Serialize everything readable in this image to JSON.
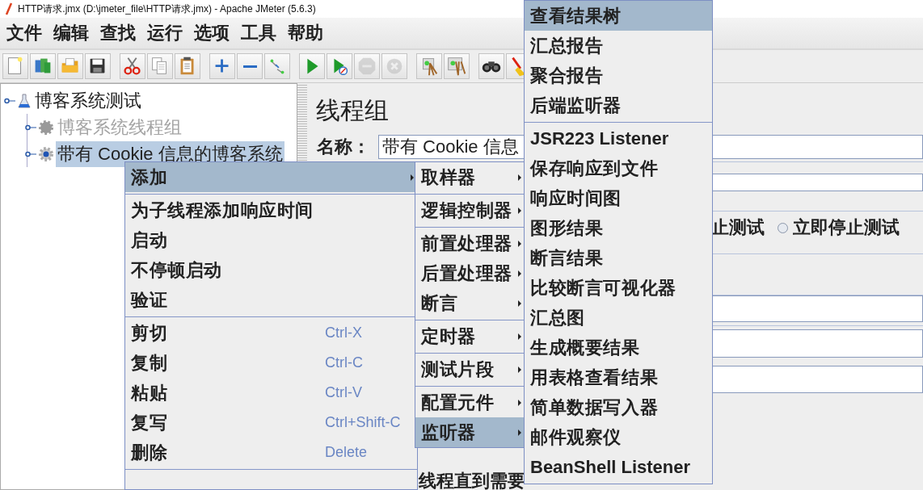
{
  "window": {
    "title": "HTTP请求.jmx (D:\\jmeter_file\\HTTP请求.jmx) - Apache JMeter (5.6.3)"
  },
  "menu_bar": [
    "文件",
    "编辑",
    "查找",
    "运行",
    "选项",
    "工具",
    "帮助"
  ],
  "toolbar": [
    [
      {
        "kind": "new",
        "disabled": false
      },
      {
        "kind": "templates",
        "disabled": false
      },
      {
        "kind": "open",
        "disabled": false
      },
      {
        "kind": "save",
        "disabled": false
      }
    ],
    [
      {
        "kind": "cut",
        "disabled": false
      },
      {
        "kind": "copy",
        "disabled": false
      },
      {
        "kind": "paste",
        "disabled": false
      }
    ],
    [
      {
        "kind": "expand",
        "disabled": false
      },
      {
        "kind": "collapse",
        "disabled": false
      },
      {
        "kind": "toggle",
        "disabled": false
      }
    ],
    [
      {
        "kind": "start",
        "disabled": false
      },
      {
        "kind": "start-no-pause",
        "disabled": false
      },
      {
        "kind": "stop",
        "disabled": true
      },
      {
        "kind": "shutdown",
        "disabled": true
      }
    ],
    [
      {
        "kind": "clear",
        "disabled": false
      },
      {
        "kind": "clear-all",
        "disabled": false
      }
    ],
    [
      {
        "kind": "search",
        "disabled": false
      },
      {
        "kind": "reset-search",
        "disabled": false
      }
    ]
  ],
  "tree": {
    "label": "博客系统测试",
    "kind": "test-plan",
    "disabled": false,
    "selected": false,
    "children": [
      {
        "label": "博客系统线程组",
        "kind": "thread-group",
        "disabled": true,
        "selected": false
      },
      {
        "label": "带有 Cookie 信息的博客系统",
        "kind": "thread-group",
        "disabled": false,
        "selected": true
      }
    ]
  },
  "panel": {
    "title": "线程组",
    "name_label": "名称：",
    "name_value": "带有 Cookie 信息",
    "action_fragment": "止测试",
    "radio": {
      "label": "立即停止测试",
      "selected": false
    },
    "bottom_fragment": "线程直到需要"
  },
  "context_menu": {
    "items": [
      {
        "kind": "item",
        "label": "添加",
        "submenu": true,
        "selected": true
      },
      {
        "kind": "separator"
      },
      {
        "kind": "item",
        "label": "为子线程添加响应时间",
        "submenu": false,
        "selected": false
      },
      {
        "kind": "item",
        "label": "启动",
        "submenu": false,
        "selected": false
      },
      {
        "kind": "item",
        "label": "不停顿启动",
        "submenu": false,
        "selected": false
      },
      {
        "kind": "item",
        "label": "验证",
        "submenu": false,
        "selected": false
      },
      {
        "kind": "separator"
      },
      {
        "kind": "item",
        "label": "剪切",
        "shortcut": "Ctrl-X",
        "submenu": false,
        "selected": false
      },
      {
        "kind": "item",
        "label": "复制",
        "shortcut": "Ctrl-C",
        "submenu": false,
        "selected": false
      },
      {
        "kind": "item",
        "label": "粘贴",
        "shortcut": "Ctrl-V",
        "submenu": false,
        "selected": false
      },
      {
        "kind": "item",
        "label": "复写",
        "shortcut": "Ctrl+Shift-C",
        "submenu": false,
        "selected": false
      },
      {
        "kind": "item",
        "label": "删除",
        "shortcut": "Delete",
        "submenu": false,
        "selected": false
      },
      {
        "kind": "separator"
      }
    ]
  },
  "add_submenu": {
    "items": [
      {
        "kind": "item",
        "label": "取样器",
        "submenu": true,
        "selected": false
      },
      {
        "kind": "separator"
      },
      {
        "kind": "item",
        "label": "逻辑控制器",
        "submenu": true,
        "selected": false
      },
      {
        "kind": "separator"
      },
      {
        "kind": "item",
        "label": "前置处理器",
        "submenu": true,
        "selected": false
      },
      {
        "kind": "item",
        "label": "后置处理器",
        "submenu": true,
        "selected": false
      },
      {
        "kind": "item",
        "label": "断言",
        "submenu": true,
        "selected": false
      },
      {
        "kind": "separator"
      },
      {
        "kind": "item",
        "label": "定时器",
        "submenu": true,
        "selected": false
      },
      {
        "kind": "separator"
      },
      {
        "kind": "item",
        "label": "测试片段",
        "submenu": true,
        "selected": false
      },
      {
        "kind": "separator"
      },
      {
        "kind": "item",
        "label": "配置元件",
        "submenu": true,
        "selected": false
      },
      {
        "kind": "item",
        "label": "监听器",
        "submenu": true,
        "selected": true
      }
    ]
  },
  "listener_submenu": {
    "items": [
      {
        "kind": "item",
        "label": "查看结果树",
        "submenu": false,
        "selected": true,
        "bold": false
      },
      {
        "kind": "item",
        "label": "汇总报告",
        "submenu": false,
        "selected": false,
        "bold": false
      },
      {
        "kind": "item",
        "label": "聚合报告",
        "submenu": false,
        "selected": false,
        "bold": false
      },
      {
        "kind": "item",
        "label": "后端监听器",
        "submenu": false,
        "selected": false,
        "bold": false
      },
      {
        "kind": "separator"
      },
      {
        "kind": "item",
        "label": "JSR223 Listener",
        "submenu": false,
        "selected": false,
        "bold": true
      },
      {
        "kind": "item",
        "label": "保存响应到文件",
        "submenu": false,
        "selected": false,
        "bold": false
      },
      {
        "kind": "item",
        "label": "响应时间图",
        "submenu": false,
        "selected": false,
        "bold": false
      },
      {
        "kind": "item",
        "label": "图形结果",
        "submenu": false,
        "selected": false,
        "bold": false
      },
      {
        "kind": "item",
        "label": "断言结果",
        "submenu": false,
        "selected": false,
        "bold": false
      },
      {
        "kind": "item",
        "label": "比较断言可视化器",
        "submenu": false,
        "selected": false,
        "bold": false
      },
      {
        "kind": "item",
        "label": "汇总图",
        "submenu": false,
        "selected": false,
        "bold": false
      },
      {
        "kind": "item",
        "label": "生成概要结果",
        "submenu": false,
        "selected": false,
        "bold": false
      },
      {
        "kind": "item",
        "label": "用表格查看结果",
        "submenu": false,
        "selected": false,
        "bold": false
      },
      {
        "kind": "item",
        "label": "简单数据写入器",
        "submenu": false,
        "selected": false,
        "bold": false
      },
      {
        "kind": "item",
        "label": "邮件观察仪",
        "submenu": false,
        "selected": false,
        "bold": false
      },
      {
        "kind": "item",
        "label": "BeanShell Listener",
        "submenu": false,
        "selected": false,
        "bold": true
      }
    ]
  }
}
